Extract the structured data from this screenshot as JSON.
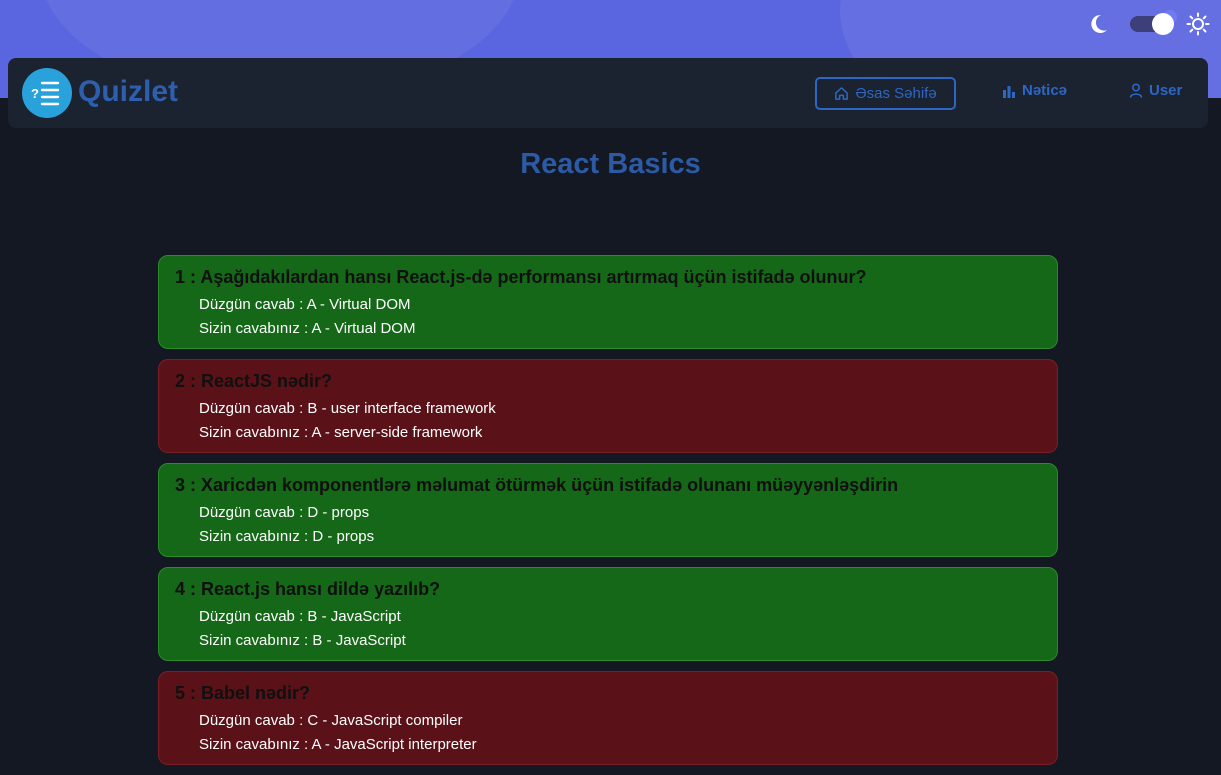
{
  "brand": {
    "name": "Quizlet"
  },
  "theme_toggle": {
    "icons": [
      "moon-icon",
      "sun-icon"
    ],
    "state": "dark"
  },
  "nav": {
    "home_label": "Əsas Səhifə",
    "result_label": "Nəticə",
    "user_label": "User"
  },
  "quiz": {
    "title": "React Basics",
    "questions": [
      {
        "number": "1 : Aşağıdakılardan hansı React.js-də performansı artırmaq üçün istifadə olunur?",
        "correct": "Düzgün cavab : A - Virtual DOM",
        "given": "Sizin cavabınız : A - Virtual DOM",
        "status": "correct"
      },
      {
        "number": "2 : ReactJS nədir?",
        "correct": "Düzgün cavab : B - user interface framework",
        "given": "Sizin cavabınız : A - server-side framework",
        "status": "wrong"
      },
      {
        "number": "3 : Xaricdən komponentlərə məlumat ötürmək üçün istifadə olunanı müəyyənləşdirin",
        "correct": "Düzgün cavab : D - props",
        "given": "Sizin cavabınız : D - props",
        "status": "correct"
      },
      {
        "number": "4 : React.js hansı dildə yazılıb?",
        "correct": "Düzgün cavab : B - JavaScript",
        "given": "Sizin cavabınız : B - JavaScript",
        "status": "correct"
      },
      {
        "number": "5 : Babel nədir?",
        "correct": "Düzgün cavab : C - JavaScript compiler",
        "given": "Sizin cavabınız : A - JavaScript interpreter",
        "status": "wrong"
      }
    ]
  },
  "colors": {
    "correct_bg": "#156817",
    "wrong_bg": "#5a1218",
    "accent": "#2e66c4",
    "header_band": "#5a65e0"
  }
}
